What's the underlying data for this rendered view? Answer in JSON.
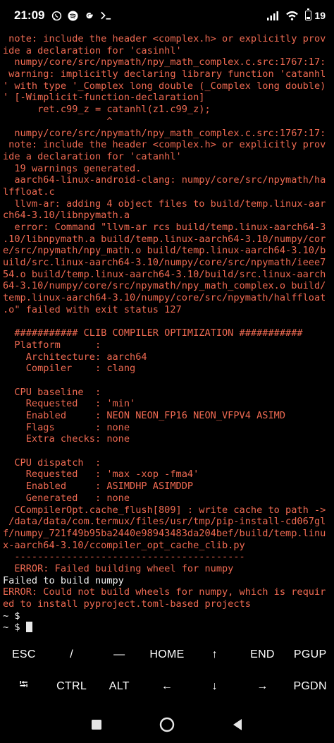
{
  "statusbar": {
    "time": "21:09",
    "battery": "19"
  },
  "terminal": {
    "lines": [
      {
        "text": " note: include the header <complex.h> or explicitly prov",
        "color": "red"
      },
      {
        "text": "ide a declaration for 'casinhl'",
        "color": "red"
      },
      {
        "text": "  numpy/core/src/npymath/npy_math_complex.c.src:1767:17:",
        "color": "red"
      },
      {
        "text": " warning: implicitly declaring library function 'catanhl",
        "color": "red"
      },
      {
        "text": "' with type '_Complex long double (_Complex long double)",
        "color": "red"
      },
      {
        "text": "' [-Wimplicit-function-declaration]",
        "color": "red"
      },
      {
        "text": "      ret.c99_z = catanhl(z1.c99_z);",
        "color": "red"
      },
      {
        "text": "                  ^",
        "color": "red"
      },
      {
        "text": "  numpy/core/src/npymath/npy_math_complex.c.src:1767:17:",
        "color": "red"
      },
      {
        "text": " note: include the header <complex.h> or explicitly prov",
        "color": "red"
      },
      {
        "text": "ide a declaration for 'catanhl'",
        "color": "red"
      },
      {
        "text": "  19 warnings generated.",
        "color": "red"
      },
      {
        "text": "  aarch64-linux-android-clang: numpy/core/src/npymath/ha",
        "color": "red"
      },
      {
        "text": "lffloat.c",
        "color": "red"
      },
      {
        "text": "  llvm-ar: adding 4 object files to build/temp.linux-aar",
        "color": "red"
      },
      {
        "text": "ch64-3.10/libnpymath.a",
        "color": "red"
      },
      {
        "text": "  error: Command \"llvm-ar rcs build/temp.linux-aarch64-3",
        "color": "red"
      },
      {
        "text": ".10/libnpymath.a build/temp.linux-aarch64-3.10/numpy/cor",
        "color": "red"
      },
      {
        "text": "e/src/npymath/npy_math.o build/temp.linux-aarch64-3.10/b",
        "color": "red"
      },
      {
        "text": "uild/src.linux-aarch64-3.10/numpy/core/src/npymath/ieee7",
        "color": "red"
      },
      {
        "text": "54.o build/temp.linux-aarch64-3.10/build/src.linux-aarch",
        "color": "red"
      },
      {
        "text": "64-3.10/numpy/core/src/npymath/npy_math_complex.o build/",
        "color": "red"
      },
      {
        "text": "temp.linux-aarch64-3.10/numpy/core/src/npymath/halffloat",
        "color": "red"
      },
      {
        "text": ".o\" failed with exit status 127",
        "color": "red"
      },
      {
        "text": "",
        "color": "red"
      },
      {
        "text": "  ########### CLIB COMPILER OPTIMIZATION ###########",
        "color": "red"
      },
      {
        "text": "  Platform      :",
        "color": "red"
      },
      {
        "text": "    Architecture: aarch64",
        "color": "red"
      },
      {
        "text": "    Compiler    : clang",
        "color": "red"
      },
      {
        "text": "",
        "color": "red"
      },
      {
        "text": "  CPU baseline  :",
        "color": "red"
      },
      {
        "text": "    Requested   : 'min'",
        "color": "red"
      },
      {
        "text": "    Enabled     : NEON NEON_FP16 NEON_VFPV4 ASIMD",
        "color": "red"
      },
      {
        "text": "    Flags       : none",
        "color": "red"
      },
      {
        "text": "    Extra checks: none",
        "color": "red"
      },
      {
        "text": "",
        "color": "red"
      },
      {
        "text": "  CPU dispatch  :",
        "color": "red"
      },
      {
        "text": "    Requested   : 'max -xop -fma4'",
        "color": "red"
      },
      {
        "text": "    Enabled     : ASIMDHP ASIMDDP",
        "color": "red"
      },
      {
        "text": "    Generated   : none",
        "color": "red"
      },
      {
        "text": "  CCompilerOpt.cache_flush[809] : write cache to path ->",
        "color": "red"
      },
      {
        "text": " /data/data/com.termux/files/usr/tmp/pip-install-cd067gl",
        "color": "red"
      },
      {
        "text": "f/numpy_721f49b95ba2440e98943483da204bef/build/temp.linu",
        "color": "red"
      },
      {
        "text": "x-aarch64-3.10/ccompiler_opt_cache_clib.py",
        "color": "red"
      },
      {
        "text": "  ----------------------------------------",
        "color": "red"
      },
      {
        "text": "  ERROR: Failed building wheel for numpy",
        "color": "red"
      },
      {
        "text": "Failed to build numpy",
        "color": "white"
      },
      {
        "text": "ERROR: Could not build wheels for numpy, which is requir",
        "color": "red"
      },
      {
        "text": "ed to install pyproject.toml-based projects",
        "color": "red"
      },
      {
        "text": "~ $",
        "color": "white"
      }
    ],
    "prompt": "~ $ "
  },
  "extrakeys": {
    "row1": [
      "ESC",
      "/",
      "—",
      "HOME",
      "↑",
      "END",
      "PGUP"
    ],
    "row2": [
      "⭾",
      "CTRL",
      "ALT",
      "←",
      "↓",
      "→",
      "PGDN"
    ]
  },
  "icons": {
    "statusbar": [
      "whatsapp-icon",
      "spotify-icon",
      "google-icon",
      "terminal-icon",
      "signal-icon",
      "wifi-icon",
      "battery-icon"
    ],
    "nav": [
      "recents-icon",
      "home-icon",
      "back-icon"
    ]
  }
}
